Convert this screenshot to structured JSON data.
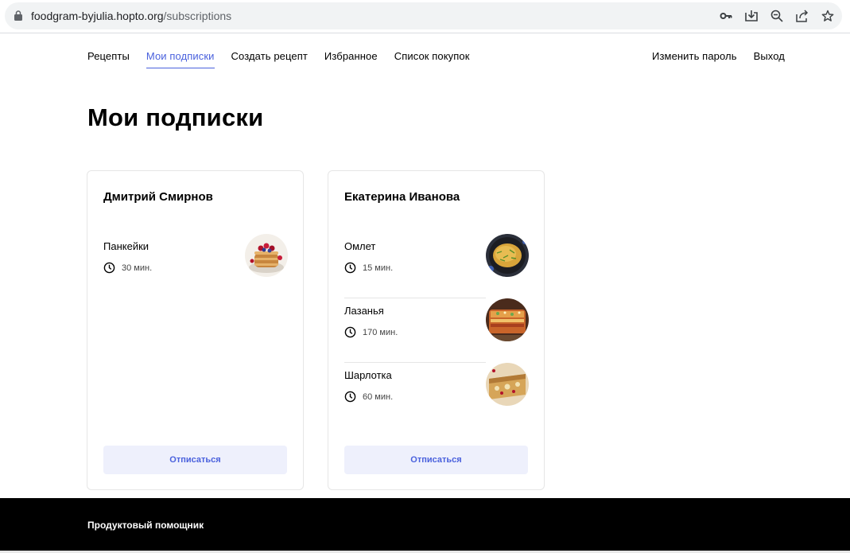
{
  "browser": {
    "url_host": "foodgram-byjulia.hopto.org",
    "url_path": "/subscriptions",
    "icons": [
      "key-icon",
      "install-icon",
      "zoom-out-icon",
      "share-icon",
      "star-icon"
    ]
  },
  "nav": {
    "items": [
      {
        "label": "Рецепты",
        "active": false
      },
      {
        "label": "Мои подписки",
        "active": true
      },
      {
        "label": "Создать рецепт",
        "active": false
      },
      {
        "label": "Избранное",
        "active": false
      },
      {
        "label": "Список покупок",
        "active": false
      }
    ],
    "right": [
      {
        "label": "Изменить пароль"
      },
      {
        "label": "Выход"
      }
    ]
  },
  "page": {
    "title": "Мои подписки"
  },
  "subscriptions": [
    {
      "author": "Дмитрий Смирнов",
      "recipes": [
        {
          "name": "Панкейки",
          "time": "30 мин.",
          "image": "pancakes"
        }
      ],
      "unsubscribe_label": "Отписаться"
    },
    {
      "author": "Екатерина Иванова",
      "recipes": [
        {
          "name": "Омлет",
          "time": "15 мин.",
          "image": "omelette"
        },
        {
          "name": "Лазанья",
          "time": "170 мин.",
          "image": "lasagna"
        },
        {
          "name": "Шарлотка",
          "time": "60 мин.",
          "image": "charlotte"
        }
      ],
      "unsubscribe_label": "Отписаться"
    }
  ],
  "footer": {
    "text": "Продуктовый помощник"
  },
  "colors": {
    "accent": "#4a61dd",
    "button_bg": "#eef0fc",
    "footer_bg": "#000000"
  }
}
